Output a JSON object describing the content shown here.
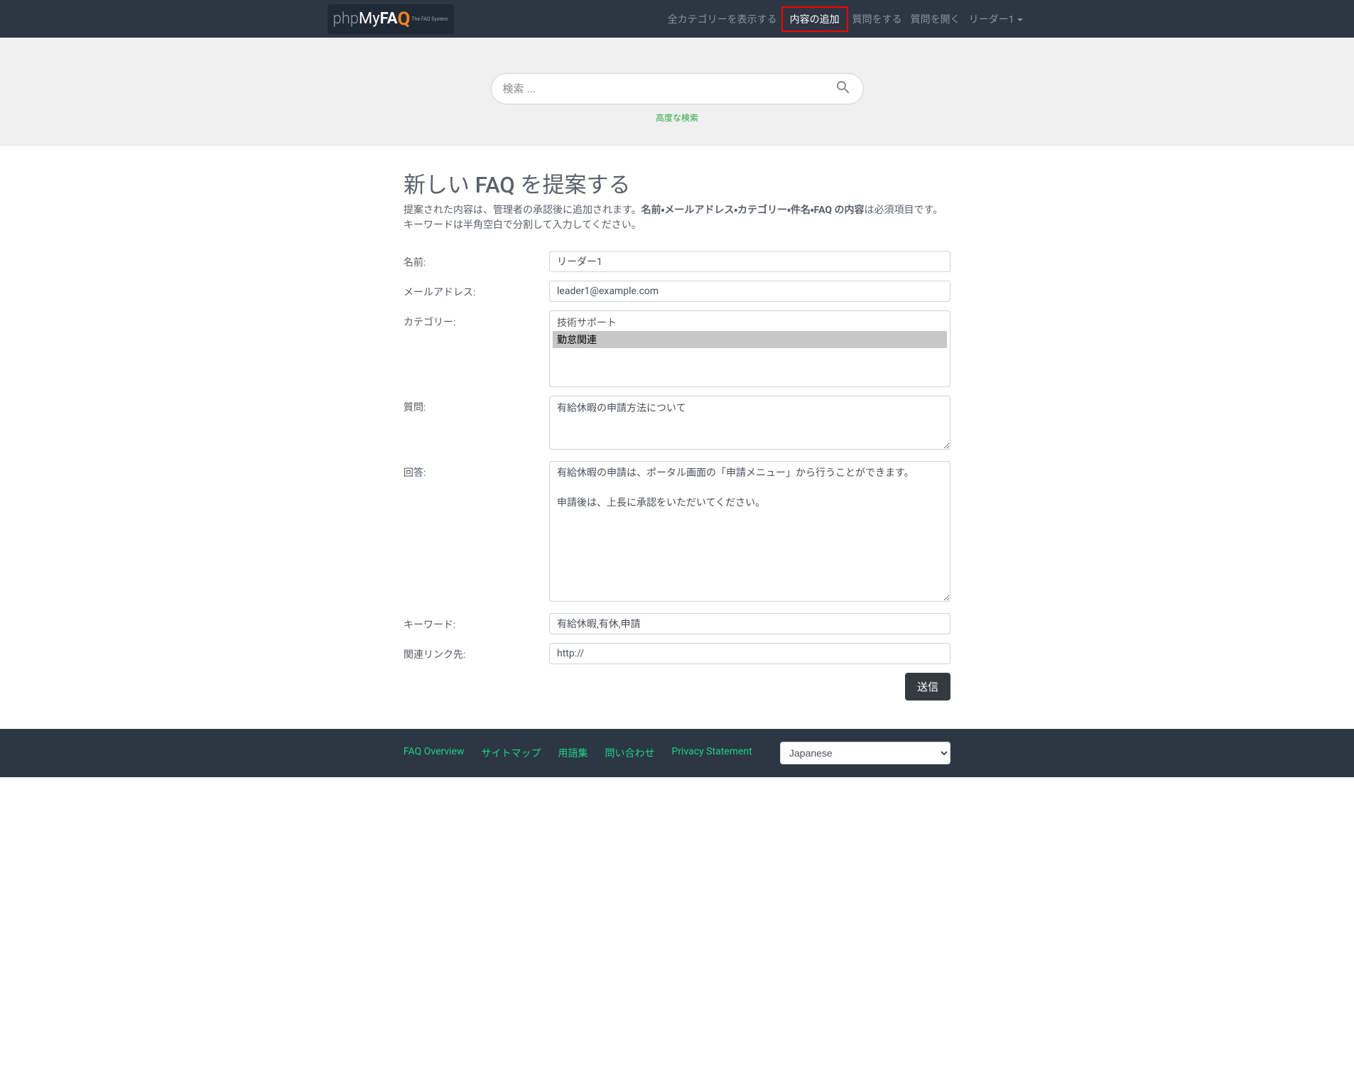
{
  "header": {
    "logo": {
      "php": "php",
      "my": "My",
      "fa": "FA",
      "q": "Q",
      "sub": "The FAQ System"
    },
    "nav": {
      "all_categories": "全カテゴリーを表示する",
      "add_content": "内容の追加",
      "ask_question": "質問をする",
      "open_questions": "質問を開く",
      "user": "リーダー1"
    }
  },
  "search": {
    "placeholder": "検索 ...",
    "advanced": "高度な検索"
  },
  "page": {
    "title": "新しい FAQ を提案する",
    "desc_pre": "提案された内容は、管理者の承認後に追加されます。",
    "desc_bold": "名前・メールアドレス・カテゴリー・件名・FAQ の内容",
    "desc_post": "は必須項目です。キーワードは半角空白で分割して入力してください。"
  },
  "form": {
    "labels": {
      "name": "名前:",
      "email": "メールアドレス:",
      "category": "カテゴリー:",
      "question": "質問:",
      "answer": "回答:",
      "keywords": "キーワード:",
      "link": "関連リンク先:"
    },
    "values": {
      "name": "リーダー1",
      "email": "leader1@example.com",
      "category_options": [
        "技術サポート",
        "勤怠関連"
      ],
      "category_selected": "勤怠関連",
      "question": "有給休暇の申請方法について",
      "answer": "有給休暇の申請は、ポータル画面の「申請メニュー」から行うことができます。\n\n申請後は、上長に承認をいただいてください。",
      "keywords": "有給休暇,有休,申請",
      "link": "http://"
    },
    "submit": "送信"
  },
  "footer": {
    "links": {
      "overview": "FAQ Overview",
      "sitemap": "サイトマップ",
      "glossary": "用語集",
      "contact": "問い合わせ",
      "privacy": "Privacy Statement"
    },
    "language": "Japanese"
  }
}
